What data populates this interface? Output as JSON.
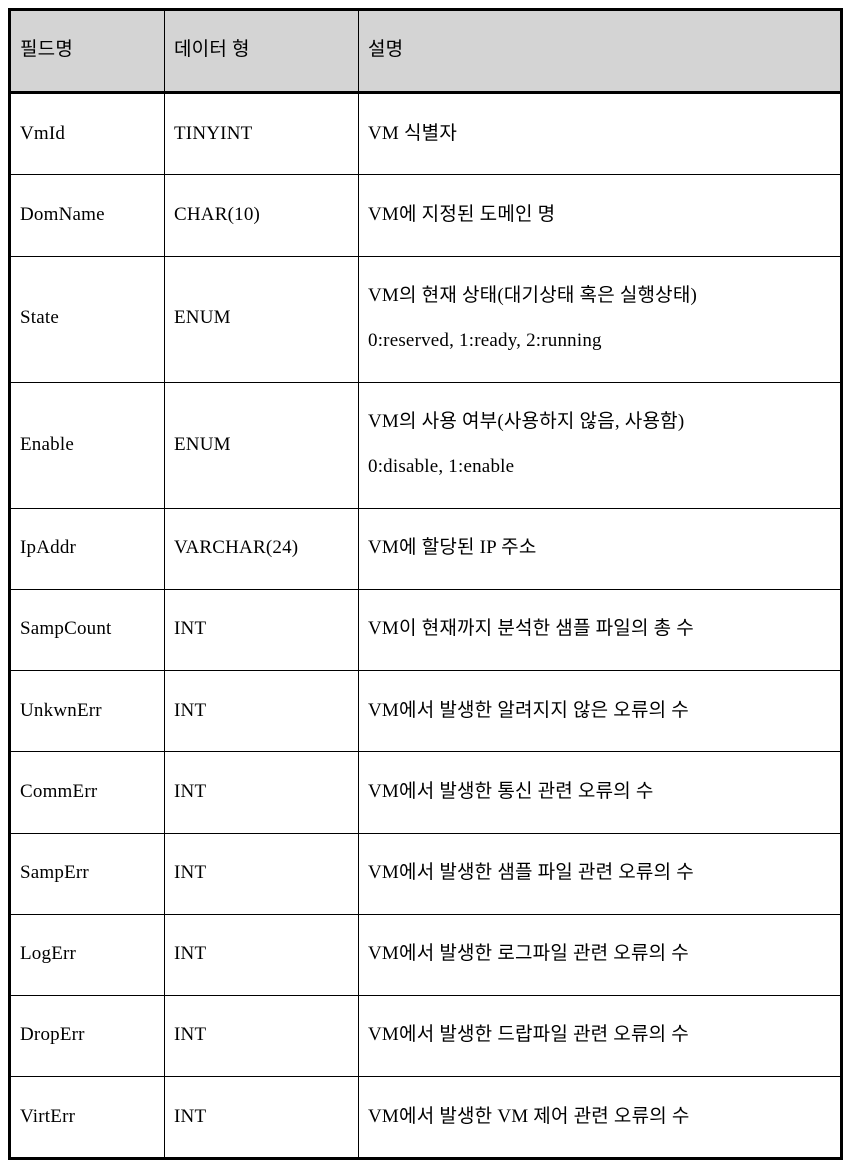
{
  "table": {
    "columns": [
      {
        "key": "field",
        "label": "필드명"
      },
      {
        "key": "type",
        "label": "데이터 형"
      },
      {
        "key": "desc",
        "label": "설명"
      }
    ],
    "rows": [
      {
        "field": "VmId",
        "type": "TINYINT",
        "desc": "VM 식별자",
        "desc_line2": ""
      },
      {
        "field": "DomName",
        "type": "CHAR(10)",
        "desc": "VM에 지정된 도메인 명",
        "desc_line2": ""
      },
      {
        "field": "State",
        "type": "ENUM",
        "desc": "VM의 현재 상태(대기상태 혹은 실행상태)",
        "desc_line2": "0:reserved, 1:ready, 2:running"
      },
      {
        "field": "Enable",
        "type": "ENUM",
        "desc": "VM의 사용 여부(사용하지 않음, 사용함)",
        "desc_line2": "0:disable, 1:enable"
      },
      {
        "field": "IpAddr",
        "type": "VARCHAR(24)",
        "desc": "VM에 할당된 IP 주소",
        "desc_line2": ""
      },
      {
        "field": "SampCount",
        "type": "INT",
        "desc": "VM이 현재까지 분석한 샘플 파일의 총 수",
        "desc_line2": ""
      },
      {
        "field": "UnkwnErr",
        "type": "INT",
        "desc": "VM에서 발생한 알려지지 않은 오류의 수",
        "desc_line2": ""
      },
      {
        "field": "CommErr",
        "type": "INT",
        "desc": "VM에서 발생한 통신 관련 오류의 수",
        "desc_line2": ""
      },
      {
        "field": "SampErr",
        "type": "INT",
        "desc": "VM에서 발생한 샘플 파일 관련 오류의 수",
        "desc_line2": ""
      },
      {
        "field": "LogErr",
        "type": "INT",
        "desc": "VM에서 발생한 로그파일 관련 오류의 수",
        "desc_line2": ""
      },
      {
        "field": "DropErr",
        "type": "INT",
        "desc": "VM에서 발생한 드랍파일 관련 오류의 수",
        "desc_line2": ""
      },
      {
        "field": "VirtErr",
        "type": "INT",
        "desc": "VM에서 발생한 VM 제어 관련 오류의 수",
        "desc_line2": ""
      }
    ]
  },
  "style": {
    "header_background": "#d4d4d4",
    "border_color": "#000000",
    "text_color": "#000000",
    "page_background": "#ffffff"
  }
}
